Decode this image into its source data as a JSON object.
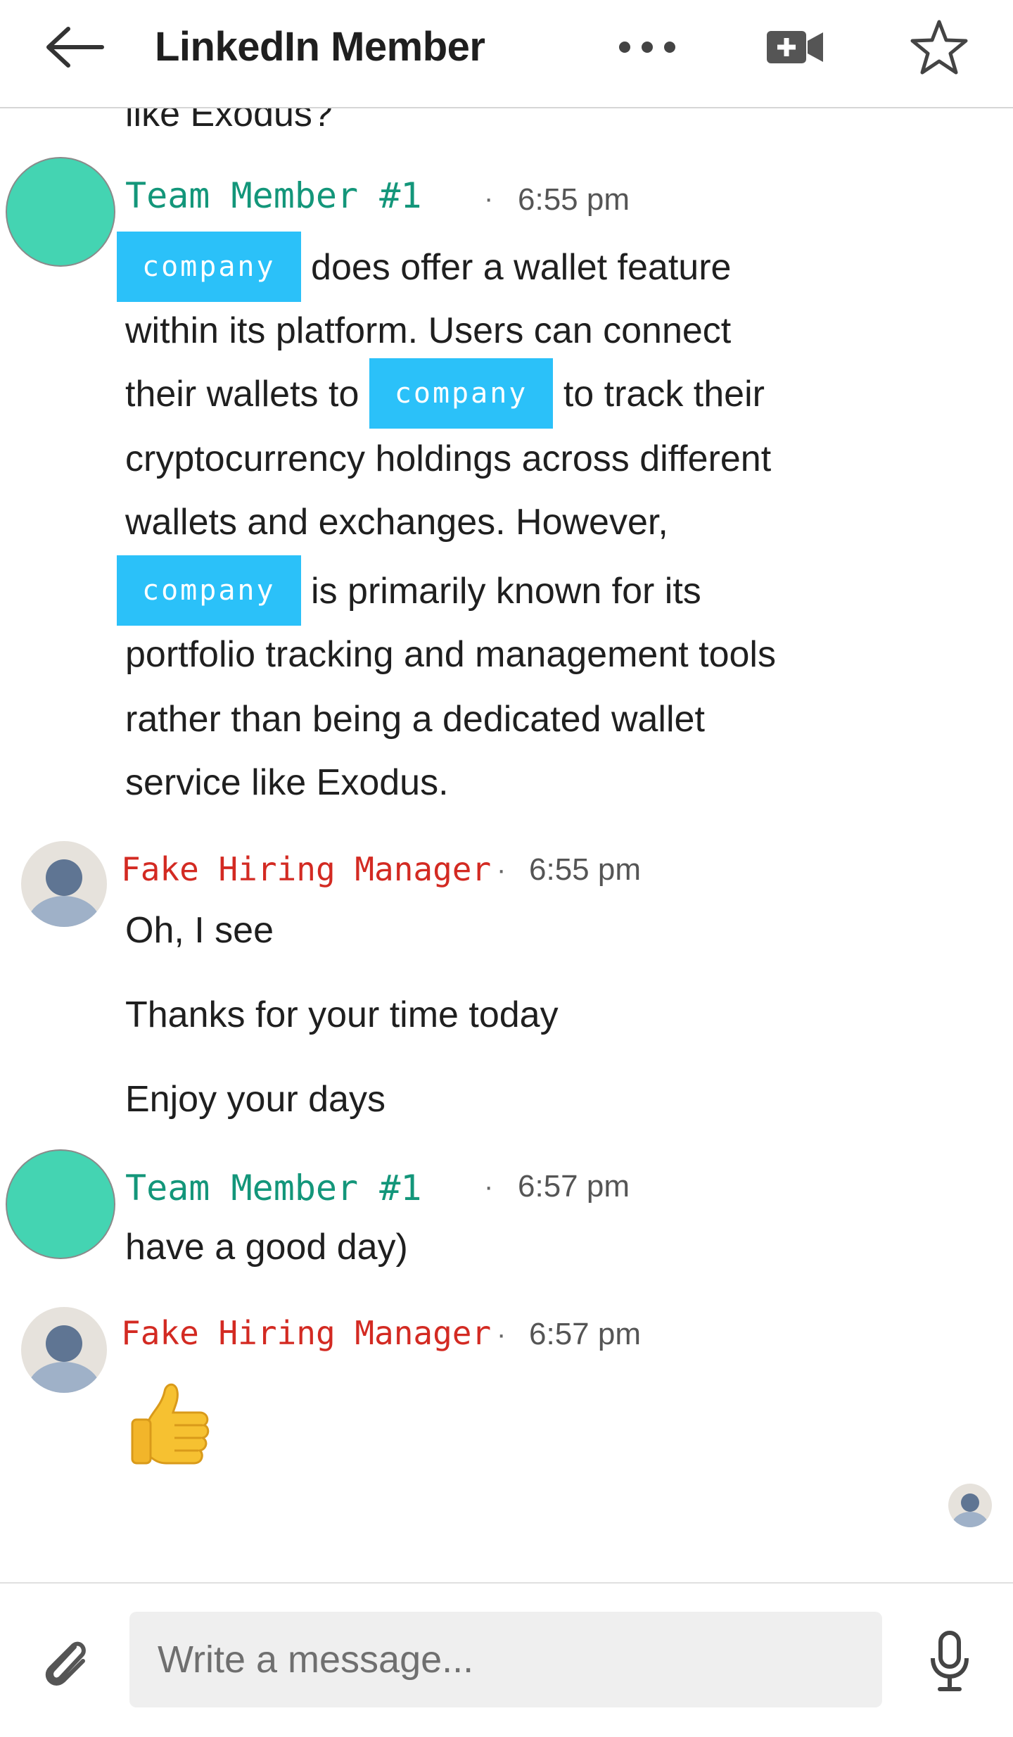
{
  "header": {
    "title": "LinkedIn Member",
    "back_icon": "arrow-left-icon",
    "more_icon": "more-horizontal-icon",
    "video_icon": "video-call-icon",
    "star_icon": "star-outline-icon"
  },
  "previous_tail": "like Exodus?",
  "messages": [
    {
      "sender": "Team Member #1",
      "time": "6:55 pm",
      "lines": [
        {
          "redact": "company",
          "text": " does offer a wallet feature"
        },
        {
          "text": "within its platform. Users can connect"
        },
        {
          "pre": "their wallets to ",
          "redact": "company",
          "text": " to track their"
        },
        {
          "text": "cryptocurrency holdings across different"
        },
        {
          "text": "wallets and exchanges. However,"
        },
        {
          "redact": "company",
          "text": " is primarily known for its"
        },
        {
          "text": "portfolio tracking and management tools"
        },
        {
          "text": "rather than being a dedicated wallet"
        },
        {
          "text": "service like Exodus."
        }
      ]
    },
    {
      "sender": "Fake Hiring Manager",
      "time": "6:55 pm",
      "paragraphs": [
        "Oh, I see",
        "Thanks for your time today",
        "Enjoy your days"
      ]
    },
    {
      "sender": "Team Member #1",
      "time": "6:57 pm",
      "paragraphs": [
        "have a good day)"
      ]
    },
    {
      "sender": "Fake Hiring Manager",
      "time": "6:57 pm",
      "emoji": "thumbs-up-icon"
    }
  ],
  "composer": {
    "placeholder": "Write a message...",
    "attach_icon": "paperclip-icon",
    "mic_icon": "microphone-icon"
  },
  "colors": {
    "team_member": "#13967a",
    "hiring_manager": "#d32a22",
    "redaction": "#2bc1f9",
    "avatar_green": "#44d4b2"
  }
}
